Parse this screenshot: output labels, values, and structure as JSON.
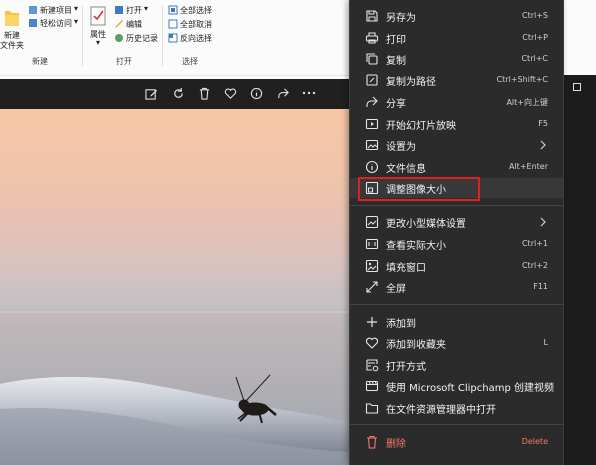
{
  "ribbon": {
    "new_folder_line1": "新建",
    "new_folder_line2": "文件夹",
    "new_item": "新建项目",
    "easy_access": "轻松访问",
    "group_new": "新建",
    "properties": "属性",
    "open": "打开",
    "edit": "编辑",
    "history": "历史记录",
    "group_open": "打开",
    "select_all": "全部选择",
    "select_none": "全部取消",
    "invert_selection": "反向选择",
    "group_select": "选择"
  },
  "toolbar": {
    "icons": [
      "edit-image-icon",
      "rotate-icon",
      "delete-icon",
      "favorite-icon",
      "info-icon",
      "share-icon",
      "more-icon"
    ]
  },
  "menu": {
    "items": [
      {
        "label": "另存为",
        "shortcut": "Ctrl+S"
      },
      {
        "label": "打印",
        "shortcut": "Ctrl+P"
      },
      {
        "label": "复制",
        "shortcut": "Ctrl+C"
      },
      {
        "label": "复制为路径",
        "shortcut": "Ctrl+Shift+C"
      },
      {
        "label": "分享",
        "shortcut": "Alt+向上键"
      },
      {
        "label": "开始幻灯片放映",
        "shortcut": "F5"
      },
      {
        "label": "设置为",
        "shortcut": ""
      },
      {
        "label": "文件信息",
        "shortcut": "Alt+Enter"
      },
      {
        "label": "调整图像大小",
        "shortcut": ""
      },
      {
        "label": "更改小型媒体设置",
        "shortcut": ""
      },
      {
        "label": "查看实际大小",
        "shortcut": "Ctrl+1"
      },
      {
        "label": "填充窗口",
        "shortcut": "Ctrl+2"
      },
      {
        "label": "全屏",
        "shortcut": "F11"
      },
      {
        "label": "添加到",
        "shortcut": ""
      },
      {
        "label": "添加到收藏夹",
        "shortcut": "L"
      },
      {
        "label": "打开方式",
        "shortcut": ""
      },
      {
        "label": "使用 Microsoft Clipchamp 创建视频",
        "shortcut": ""
      },
      {
        "label": "在文件资源管理器中打开",
        "shortcut": ""
      },
      {
        "label": "删除",
        "shortcut": "Delete"
      }
    ]
  },
  "colors": {
    "menu_bg": "#2b2b2b",
    "highlight_box": "#e02020",
    "danger": "#f07a6a"
  }
}
